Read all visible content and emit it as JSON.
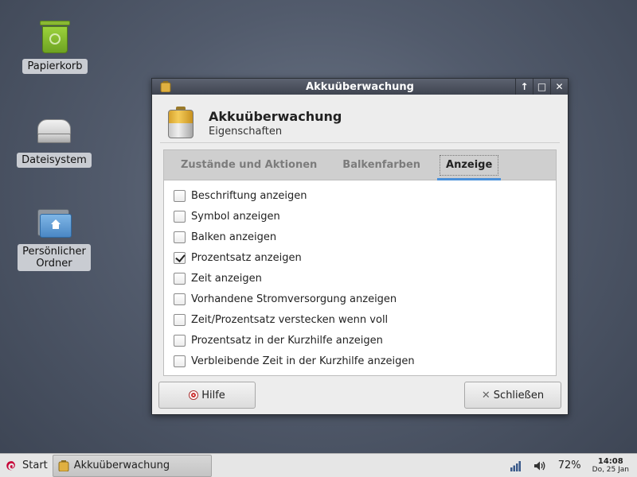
{
  "desktop": {
    "icons": [
      {
        "label": "Papierkorb",
        "icon": "trash-icon"
      },
      {
        "label": "Dateisystem",
        "icon": "filesystem-icon"
      },
      {
        "label": "Persönlicher\nOrdner",
        "icon": "home-folder-icon"
      }
    ]
  },
  "window": {
    "title": "Akkuüberwachung",
    "buttons": {
      "up": "↑",
      "maximize": "□",
      "close": "✕"
    },
    "header": {
      "title": "Akkuüberwachung",
      "subtitle": "Eigenschaften"
    },
    "tabs": [
      {
        "label": "Zustände und Aktionen",
        "active": false
      },
      {
        "label": "Balkenfarben",
        "active": false
      },
      {
        "label": "Anzeige",
        "active": true
      }
    ],
    "options": [
      {
        "label": "Beschriftung anzeigen",
        "checked": false
      },
      {
        "label": "Symbol anzeigen",
        "checked": false
      },
      {
        "label": "Balken anzeigen",
        "checked": false
      },
      {
        "label": "Prozentsatz anzeigen",
        "checked": true
      },
      {
        "label": "Zeit anzeigen",
        "checked": false
      },
      {
        "label": "Vorhandene Stromversorgung anzeigen",
        "checked": false
      },
      {
        "label": "Zeit/Prozentsatz verstecken wenn voll",
        "checked": false
      },
      {
        "label": "Prozentsatz in der Kurzhilfe anzeigen",
        "checked": false
      },
      {
        "label": "Verbleibende Zeit in der Kurzhilfe anzeigen",
        "checked": false
      }
    ],
    "help_label": "Hilfe",
    "close_label": "Schließen"
  },
  "taskbar": {
    "start_label": "Start",
    "task_label": "Akkuüberwachung",
    "battery_percent": "72%",
    "clock_time": "14:08",
    "clock_date": "Do, 25 Jan"
  },
  "colors": {
    "accent": "#4a90d9",
    "titlebar": "#4a505c",
    "battery": "#e0b040"
  }
}
